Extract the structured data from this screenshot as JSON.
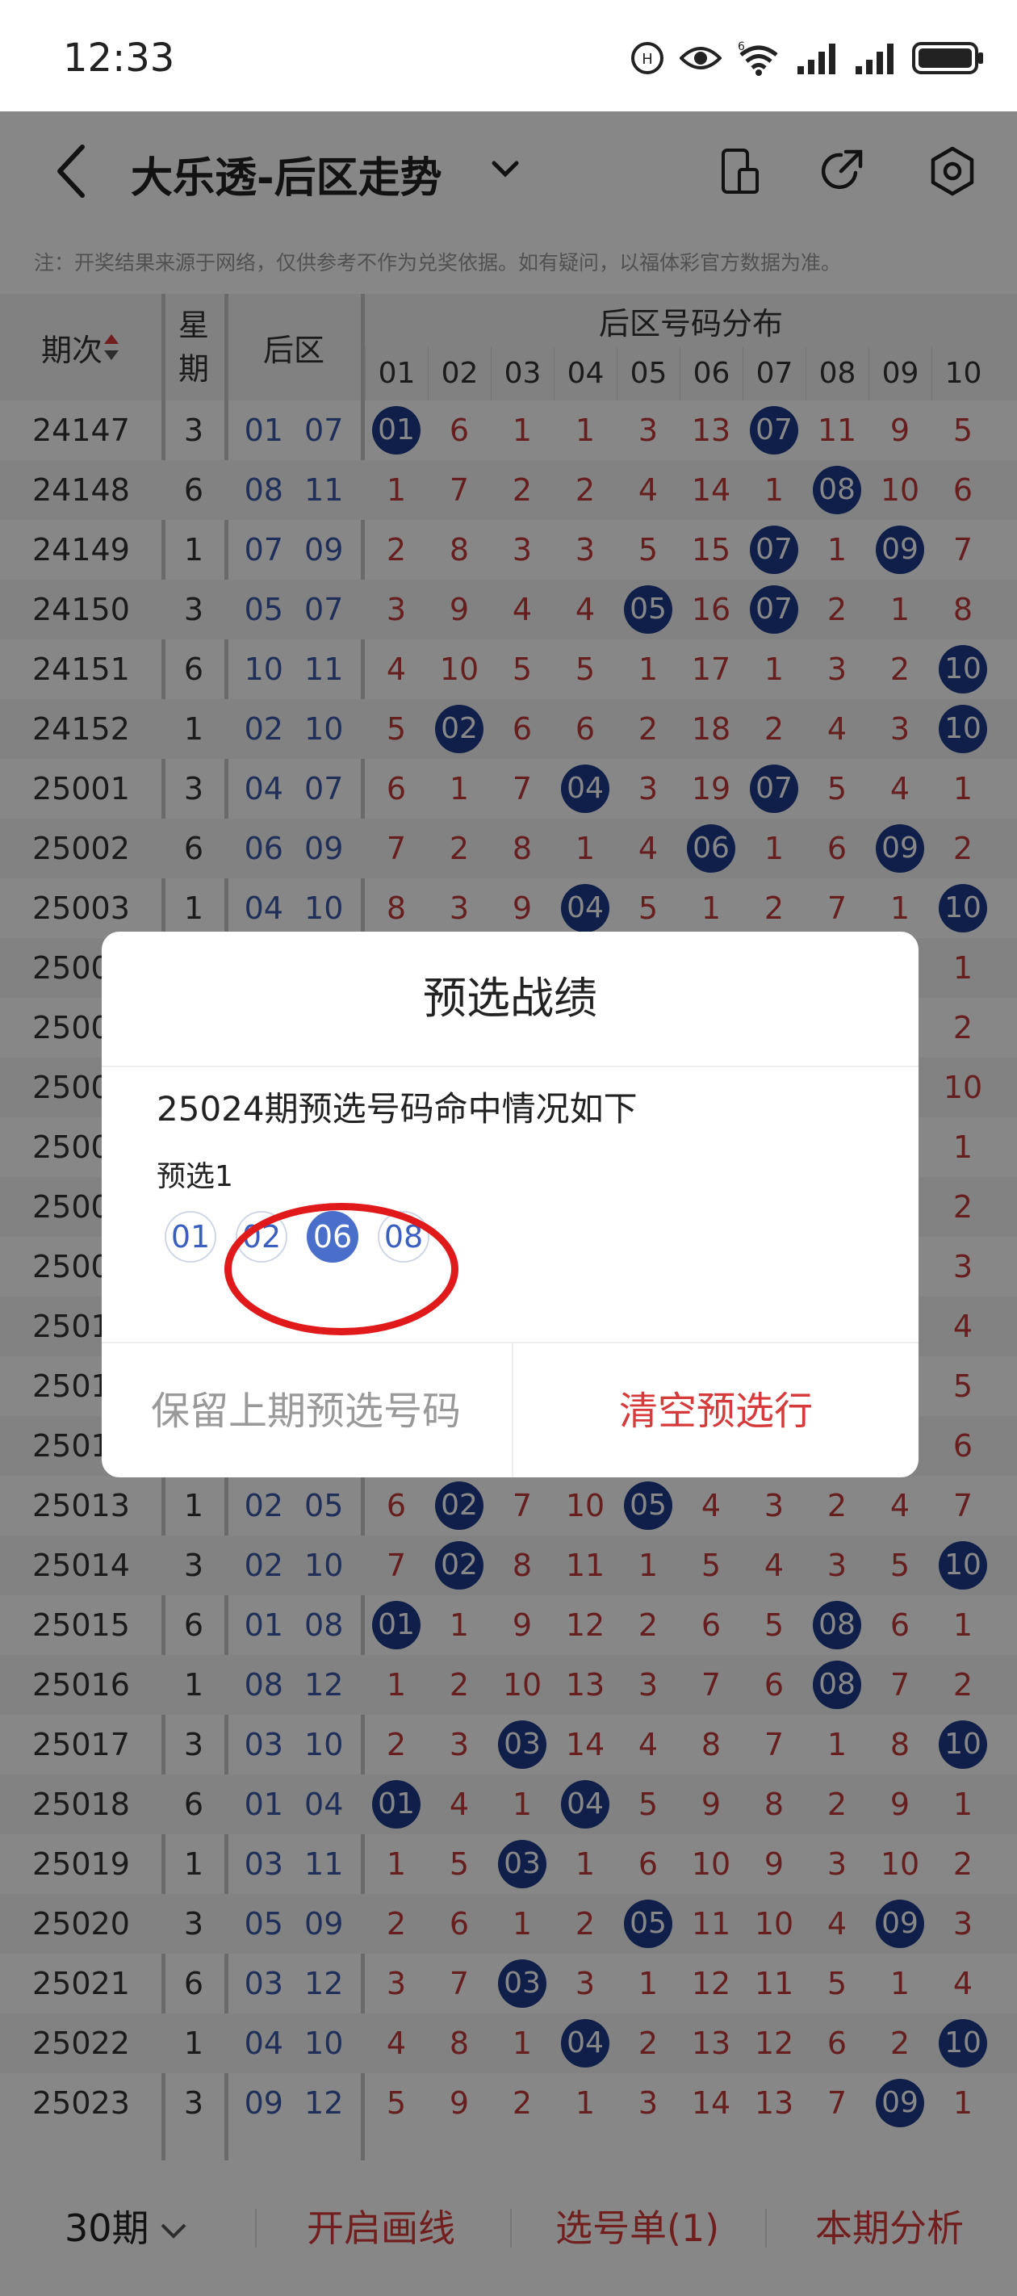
{
  "status_bar": {
    "time": "12:33",
    "network_label": "6"
  },
  "navbar": {
    "title": "大乐透-后区走势"
  },
  "notice": "注：开奖结果来源于网络，仅供参考不作为兑奖依据。如有疑问，以福体彩官方数据为准。",
  "table": {
    "headers": {
      "issue": "期次",
      "week_1": "星",
      "week_2": "期",
      "back": "后区",
      "distribution": "后区号码分布"
    },
    "columns": [
      "01",
      "02",
      "03",
      "04",
      "05",
      "06",
      "07",
      "08",
      "09",
      "10"
    ],
    "rows": [
      {
        "issue": "24147",
        "week": "3",
        "back": "01 07",
        "cells": [
          "01",
          "6",
          "1",
          "1",
          "3",
          "13",
          "07",
          "11",
          "9",
          "5"
        ]
      },
      {
        "issue": "24148",
        "week": "6",
        "back": "08 11",
        "cells": [
          "1",
          "7",
          "2",
          "2",
          "4",
          "14",
          "1",
          "08",
          "10",
          "6"
        ]
      },
      {
        "issue": "24149",
        "week": "1",
        "back": "07 09",
        "cells": [
          "2",
          "8",
          "3",
          "3",
          "5",
          "15",
          "07",
          "1",
          "09",
          "7"
        ]
      },
      {
        "issue": "24150",
        "week": "3",
        "back": "05 07",
        "cells": [
          "3",
          "9",
          "4",
          "4",
          "05",
          "16",
          "07",
          "2",
          "1",
          "8"
        ]
      },
      {
        "issue": "24151",
        "week": "6",
        "back": "10 11",
        "cells": [
          "4",
          "10",
          "5",
          "5",
          "1",
          "17",
          "1",
          "3",
          "2",
          "10"
        ]
      },
      {
        "issue": "24152",
        "week": "1",
        "back": "02 10",
        "cells": [
          "5",
          "02",
          "6",
          "6",
          "2",
          "18",
          "2",
          "4",
          "3",
          "10"
        ]
      },
      {
        "issue": "25001",
        "week": "3",
        "back": "04 07",
        "cells": [
          "6",
          "1",
          "7",
          "04",
          "3",
          "19",
          "07",
          "5",
          "4",
          "1"
        ]
      },
      {
        "issue": "25002",
        "week": "6",
        "back": "06 09",
        "cells": [
          "7",
          "2",
          "8",
          "1",
          "4",
          "06",
          "1",
          "6",
          "09",
          "2"
        ]
      },
      {
        "issue": "25003",
        "week": "1",
        "back": "04 10",
        "cells": [
          "8",
          "3",
          "9",
          "04",
          "5",
          "1",
          "2",
          "7",
          "1",
          "10"
        ]
      },
      {
        "issue": "2500",
        "week": "",
        "back": "",
        "cells": [
          "",
          "",
          "",
          "",
          "",
          "",
          "",
          "",
          "",
          "1"
        ]
      },
      {
        "issue": "2500",
        "week": "",
        "back": "",
        "cells": [
          "",
          "",
          "",
          "",
          "",
          "",
          "",
          "",
          "",
          "2"
        ]
      },
      {
        "issue": "2500",
        "week": "",
        "back": "",
        "cells": [
          "",
          "",
          "",
          "",
          "",
          "",
          "",
          "",
          "",
          "10"
        ]
      },
      {
        "issue": "2500",
        "week": "",
        "back": "",
        "cells": [
          "",
          "",
          "",
          "",
          "",
          "",
          "",
          "",
          "",
          "1"
        ]
      },
      {
        "issue": "2500",
        "week": "",
        "back": "",
        "cells": [
          "",
          "",
          "",
          "",
          "",
          "",
          "",
          "",
          "",
          "2"
        ]
      },
      {
        "issue": "2500",
        "week": "",
        "back": "",
        "cells": [
          "",
          "",
          "",
          "",
          "",
          "",
          "",
          "",
          "",
          "3"
        ]
      },
      {
        "issue": "2501",
        "week": "",
        "back": "",
        "cells": [
          "",
          "",
          "",
          "",
          "",
          "",
          "",
          "",
          "",
          "4"
        ]
      },
      {
        "issue": "2501",
        "week": "",
        "back": "",
        "cells": [
          "",
          "",
          "",
          "",
          "",
          "",
          "",
          "",
          "",
          "5"
        ]
      },
      {
        "issue": "2501",
        "week": "",
        "back": "",
        "cells": [
          "",
          "",
          "",
          "",
          "",
          "",
          "",
          "",
          "",
          "6"
        ]
      },
      {
        "issue": "25013",
        "week": "1",
        "back": "02 05",
        "cells": [
          "6",
          "02",
          "7",
          "10",
          "05",
          "4",
          "3",
          "2",
          "4",
          "7"
        ]
      },
      {
        "issue": "25014",
        "week": "3",
        "back": "02 10",
        "cells": [
          "7",
          "02",
          "8",
          "11",
          "1",
          "5",
          "4",
          "3",
          "5",
          "10"
        ]
      },
      {
        "issue": "25015",
        "week": "6",
        "back": "01 08",
        "cells": [
          "01",
          "1",
          "9",
          "12",
          "2",
          "6",
          "5",
          "08",
          "6",
          "1"
        ]
      },
      {
        "issue": "25016",
        "week": "1",
        "back": "08 12",
        "cells": [
          "1",
          "2",
          "10",
          "13",
          "3",
          "7",
          "6",
          "08",
          "7",
          "2"
        ]
      },
      {
        "issue": "25017",
        "week": "3",
        "back": "03 10",
        "cells": [
          "2",
          "3",
          "03",
          "14",
          "4",
          "8",
          "7",
          "1",
          "8",
          "10"
        ]
      },
      {
        "issue": "25018",
        "week": "6",
        "back": "01 04",
        "cells": [
          "01",
          "4",
          "1",
          "04",
          "5",
          "9",
          "8",
          "2",
          "9",
          "1"
        ]
      },
      {
        "issue": "25019",
        "week": "1",
        "back": "03 11",
        "cells": [
          "1",
          "5",
          "03",
          "1",
          "6",
          "10",
          "9",
          "3",
          "10",
          "2"
        ]
      },
      {
        "issue": "25020",
        "week": "3",
        "back": "05 09",
        "cells": [
          "2",
          "6",
          "1",
          "2",
          "05",
          "11",
          "10",
          "4",
          "09",
          "3"
        ]
      },
      {
        "issue": "25021",
        "week": "6",
        "back": "03 12",
        "cells": [
          "3",
          "7",
          "03",
          "3",
          "1",
          "12",
          "11",
          "5",
          "1",
          "4"
        ]
      },
      {
        "issue": "25022",
        "week": "1",
        "back": "04 10",
        "cells": [
          "4",
          "8",
          "1",
          "04",
          "2",
          "13",
          "12",
          "6",
          "2",
          "10"
        ]
      },
      {
        "issue": "25023",
        "week": "3",
        "back": "09 12",
        "cells": [
          "5",
          "9",
          "2",
          "1",
          "3",
          "14",
          "13",
          "7",
          "09",
          "1"
        ]
      }
    ]
  },
  "bottom_bar": {
    "period": "30期",
    "draw_line": "开启画线",
    "pick_list": "选号单(1)",
    "analysis": "本期分析"
  },
  "dialog": {
    "title": "预选战绩",
    "subtitle": "25024期预选号码命中情况如下",
    "group_label": "预选1",
    "balls": [
      {
        "n": "01",
        "hit": false
      },
      {
        "n": "02",
        "hit": false
      },
      {
        "n": "06",
        "hit": true
      },
      {
        "n": "08",
        "hit": false
      }
    ],
    "keep_label": "保留上期预选号码",
    "clear_label": "清空预选行"
  },
  "colors": {
    "accent_red": "#d63a3a",
    "hit_blue": "#1f3c8c",
    "miss_red": "#c23a3a"
  }
}
